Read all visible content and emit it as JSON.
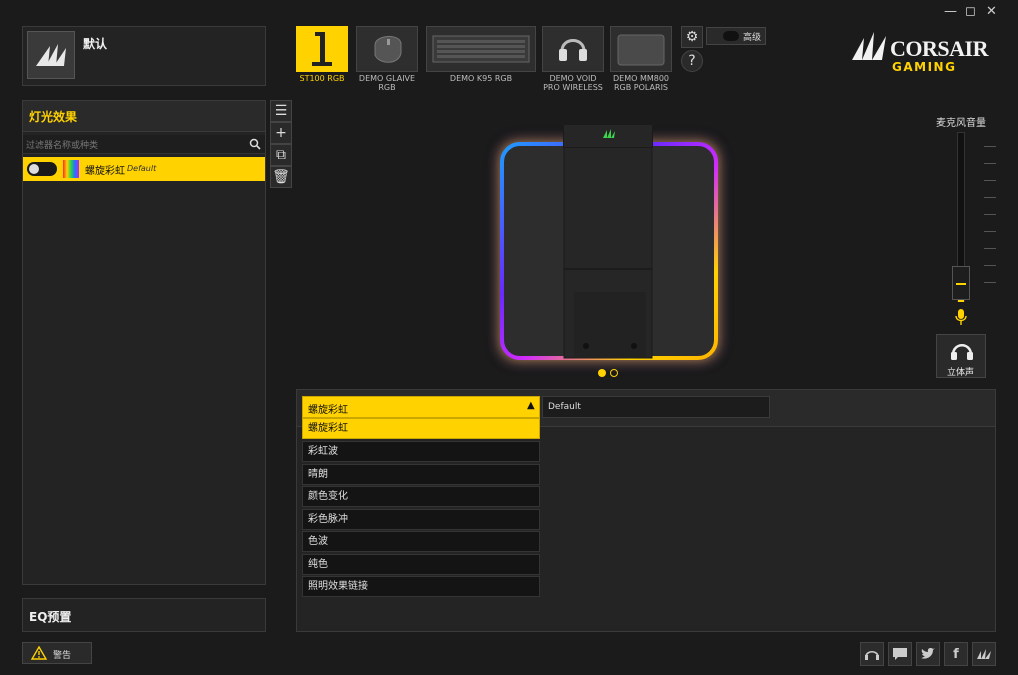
{
  "profile": {
    "name": "默认"
  },
  "lighting": {
    "title": "灯光效果",
    "search_placeholder": "过滤器名称或种类",
    "effects": [
      {
        "name": "螺旋彩虹",
        "preset": "Default",
        "selected": true
      }
    ]
  },
  "eq": {
    "title": "EQ预置"
  },
  "warning": {
    "label": "警告"
  },
  "advanced": {
    "label": "高级"
  },
  "devices": [
    {
      "label": "ST100 RGB",
      "active": true
    },
    {
      "label": "DEMO GLAIVE RGB",
      "active": false
    },
    {
      "label": "DEMO K95 RGB",
      "active": false
    },
    {
      "label": "DEMO VOID PRO WIRELESS",
      "active": false
    },
    {
      "label": "DEMO MM800 RGB POLARIS",
      "active": false
    }
  ],
  "brand": {
    "name": "CORSAIR",
    "sub": "GAMING"
  },
  "mic": {
    "label": "麦克风音量",
    "level": 0.18
  },
  "stereo": {
    "label": "立体声"
  },
  "effect_dropdown": {
    "selected": "螺旋彩虹",
    "preset": "Default",
    "options": [
      "螺旋彩虹",
      "彩虹波",
      "晴朗",
      "颜色变化",
      "彩色脉冲",
      "色波",
      "纯色",
      "照明效果链接"
    ]
  },
  "colors": {
    "accent": "#ffd200",
    "background": "#1b1b1b",
    "panel": "#232323"
  }
}
